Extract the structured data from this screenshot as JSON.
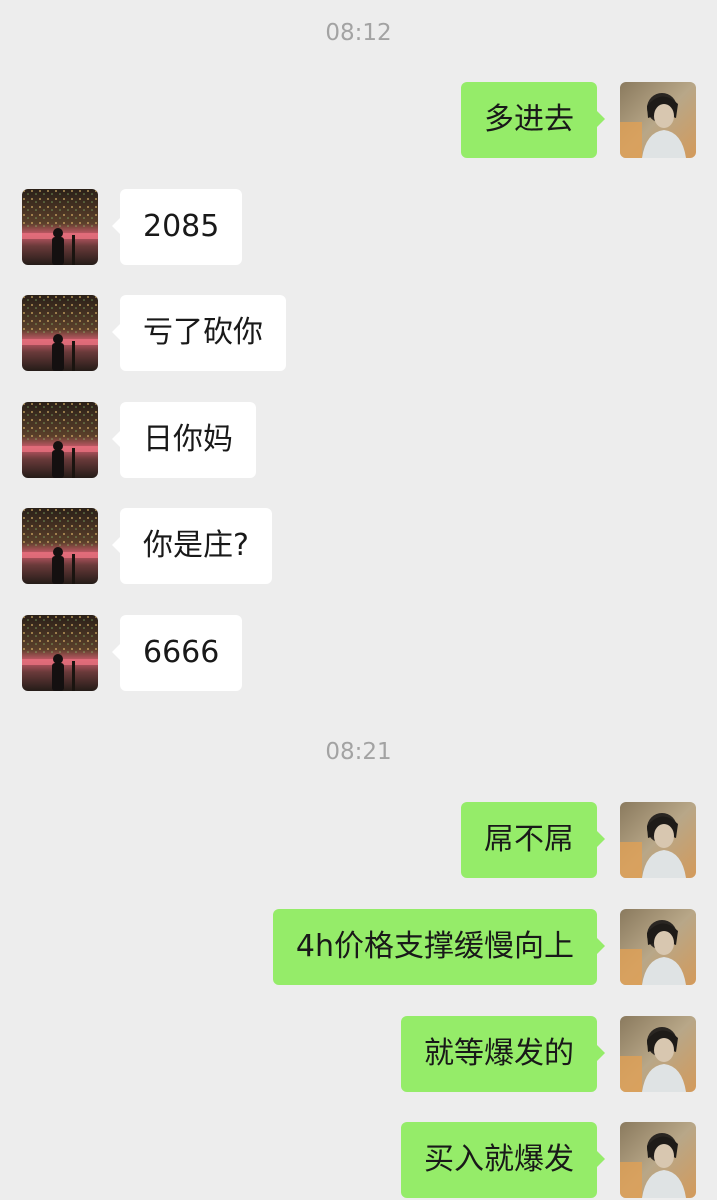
{
  "colors": {
    "background": "#ededed",
    "sent_bubble": "#95ec69",
    "received_bubble": "#ffffff",
    "timestamp_text": "#a3a3a3"
  },
  "timestamps": [
    "08:12",
    "08:21"
  ],
  "messages": [
    {
      "side": "right",
      "text": "多进去",
      "avatar": "self-avatar"
    },
    {
      "side": "left",
      "text": "2085",
      "avatar": "contact-avatar"
    },
    {
      "side": "left",
      "text": "亏了砍你",
      "avatar": "contact-avatar"
    },
    {
      "side": "left",
      "text": "日你妈",
      "avatar": "contact-avatar"
    },
    {
      "side": "left",
      "text": "你是庄?",
      "avatar": "contact-avatar"
    },
    {
      "side": "left",
      "text": "6666",
      "avatar": "contact-avatar"
    },
    {
      "side": "right",
      "text": "屌不屌",
      "avatar": "self-avatar"
    },
    {
      "side": "right",
      "text": "4h价格支撑缓慢向上",
      "avatar": "self-avatar"
    },
    {
      "side": "right",
      "text": "就等爆发的",
      "avatar": "self-avatar"
    },
    {
      "side": "right",
      "text": "买入就爆发",
      "avatar": "self-avatar"
    }
  ]
}
